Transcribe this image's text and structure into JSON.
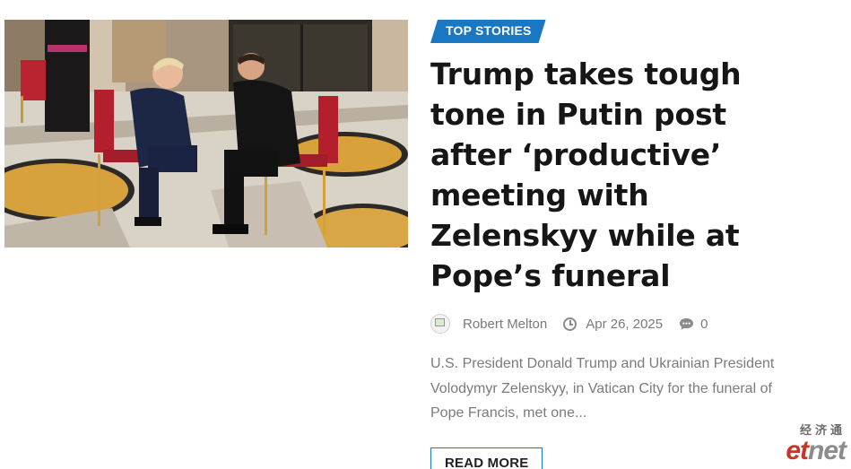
{
  "article": {
    "category": "TOP STORIES",
    "title": "Trump takes tough tone in Putin post after ‘productive’ meeting with Zelenskyy while at Pope’s funeral",
    "author": "Robert Melton",
    "date": "Apr 26, 2025",
    "comments": "0",
    "excerpt": "U.S. President Donald Trump and Ukrainian President Volodymyr Zelenskyy, in Vatican City for the funeral of Pope Francis, met one...",
    "read_more": "READ MORE"
  },
  "icons": {
    "avatar": "author-avatar",
    "date": "clock-icon",
    "comments": "comment-icon"
  },
  "watermark": {
    "cn": "经济通",
    "logo_et": "et",
    "logo_net": "net"
  },
  "colors": {
    "accent": "#1a78c2",
    "headline": "#161616",
    "meta": "#7a7a7a",
    "watermark_red": "#c7352a"
  }
}
